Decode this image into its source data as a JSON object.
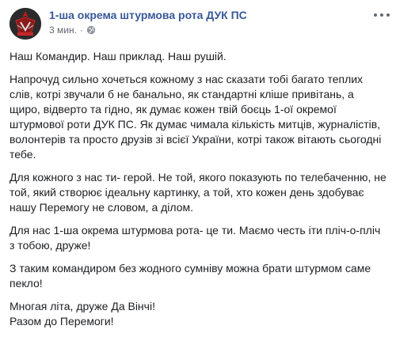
{
  "post": {
    "page_name": "1-ша окрема штурмова рота ДУК ПС",
    "time": "3 мин.",
    "dot": "·",
    "privacy_icon": "globe-icon",
    "menu_icon": "more-options-icon",
    "paragraphs": [
      "Наш Командир. Наш приклад. Наш рушій.",
      "Напрочуд сильно хочеться кожному з нас сказати тобі багато теплих слів, котрі звучали б не банально, як стандартні кліше привітань, а щиро, відверто та гідно, як думає кожен твій боєць 1-ої окремої штурмової роти ДУК ПС. Як думає чимала кількість митців, журналістів, волонтерів та просто друзів зі всієї України, котрі також вітають сьогодні тебе.",
      "Для кожного з нас ти- герой. Не той, якого показують по телебаченню, не той, який створює ідеальну картинку, а той, хто кожен день здобуває нашу Перемогу не словом, а ділом.",
      "Для нас 1-ша окрема штурмова рота- це ти. Маємо честь іти пліч-о-пліч з тобою, друже!",
      "З таким командиром без жодного сумніву можна брати штурмом саме пекло!",
      "Многая літа, друже Да Вінчі!\nРазом до Перемоги!"
    ]
  }
}
